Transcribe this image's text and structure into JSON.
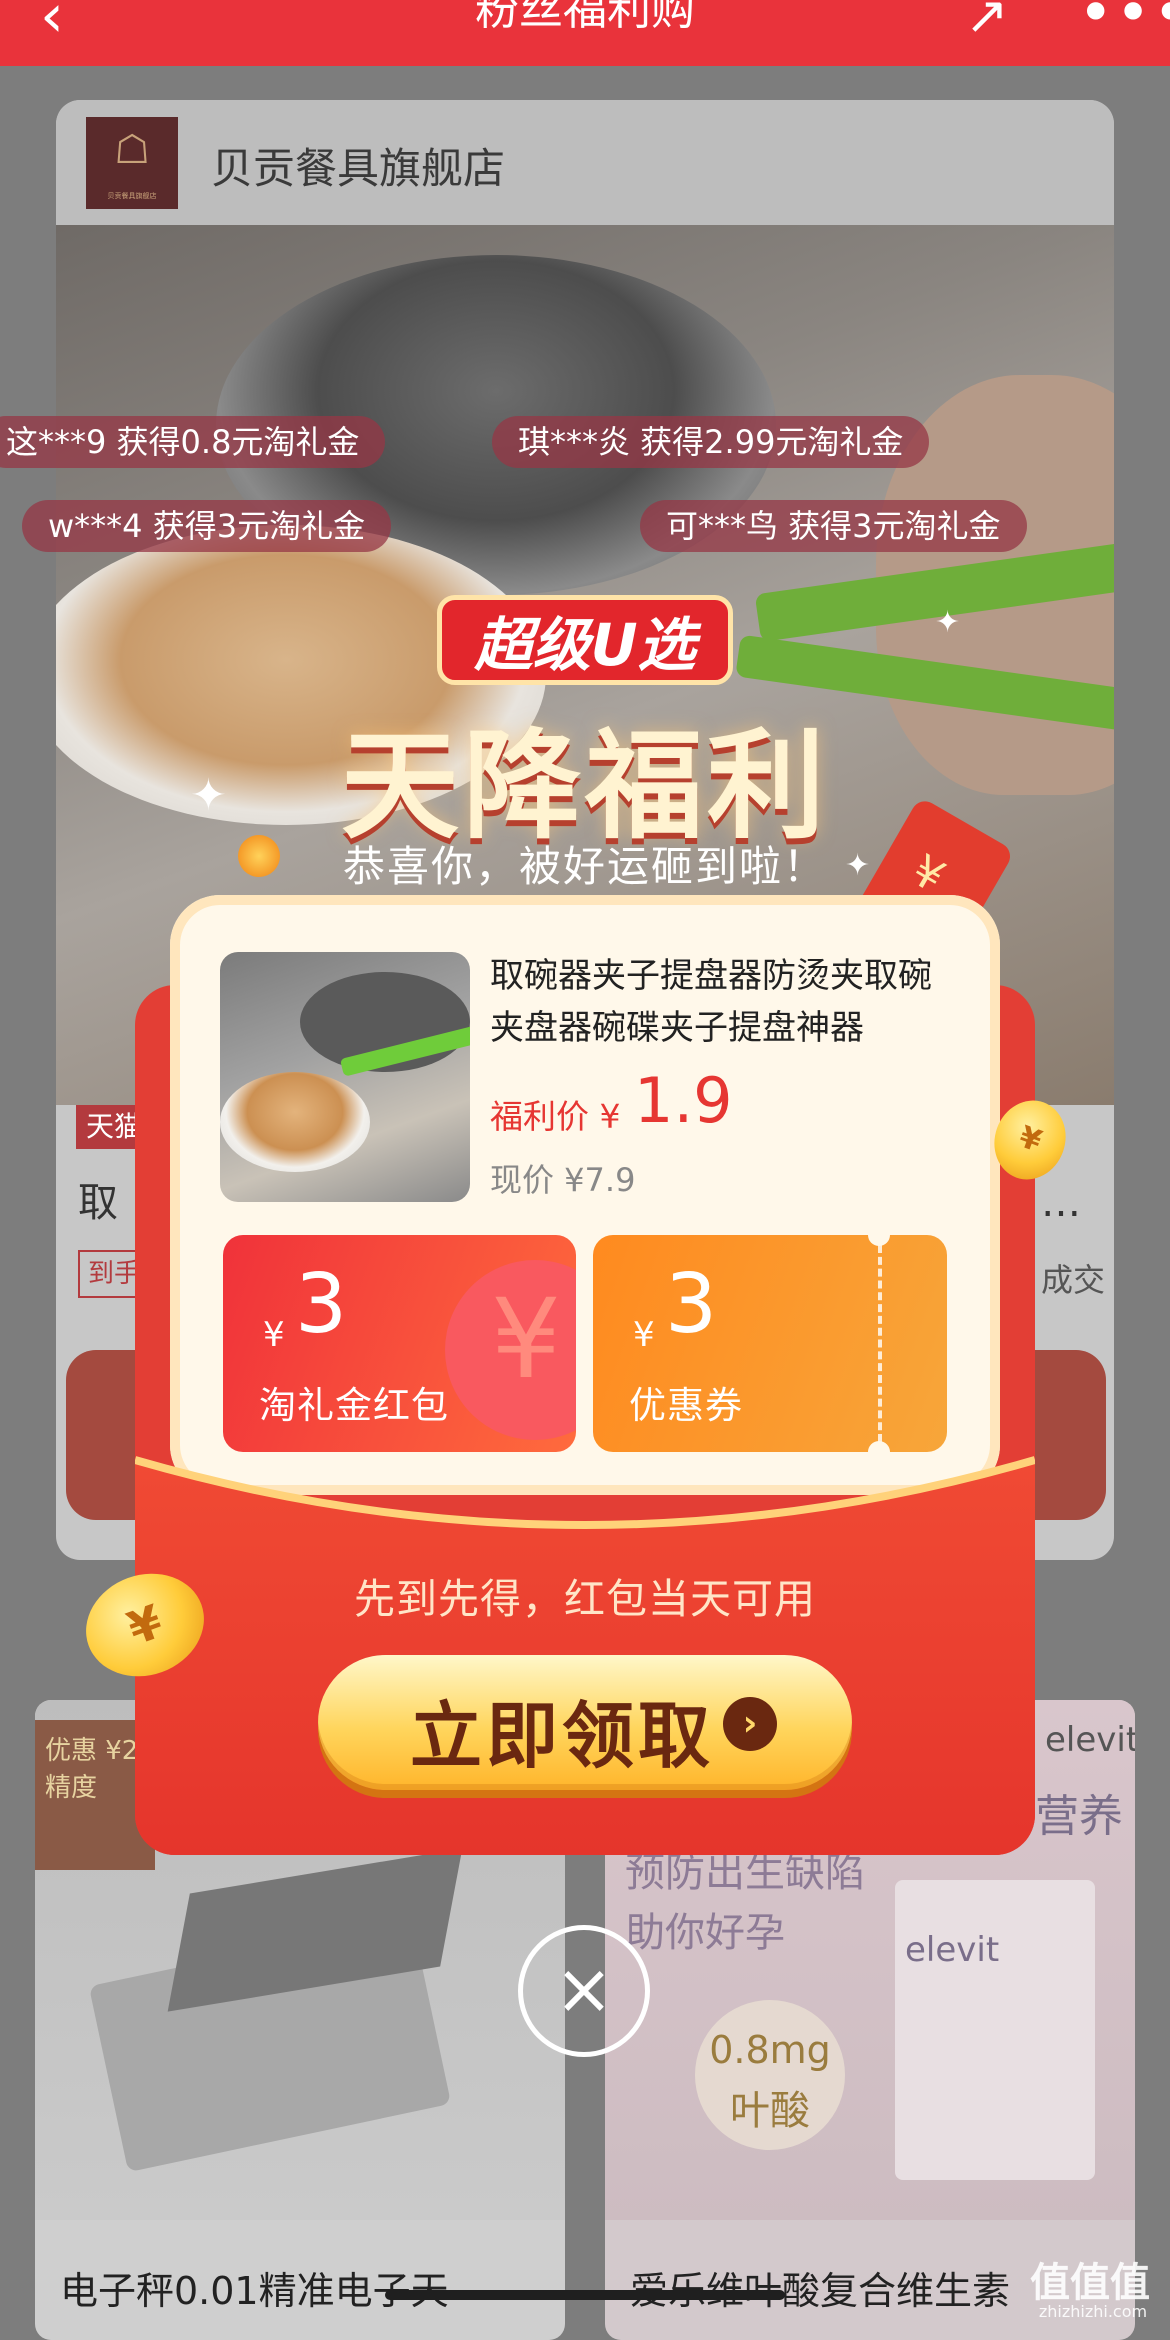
{
  "topbar": {
    "title": "粉丝福利购",
    "back_icon": "‹",
    "share_icon": "↗",
    "more_icon": "•••"
  },
  "store": {
    "name": "贝贡餐具旗舰店",
    "logo_glyph": "☖",
    "logo_caption": "贝贡餐具旗舰店"
  },
  "background": {
    "tag": "天猫",
    "title_start": "取",
    "title_end": "…",
    "sub_tag": "到手",
    "sub_end": "成交",
    "tiles": [
      {
        "name": "电子秤0.01精准电子天",
        "badge": "优惠 ¥2 精度"
      },
      {
        "name": "爱乐维叶酸复合维生素",
        "brand": "elevit",
        "head": "营养",
        "line1": "预防出生缺陷",
        "line2": "助你好孕",
        "dose": "0.8mg",
        "dose_label": "叶酸"
      }
    ]
  },
  "tickers": [
    "这***9 获得0.8元淘礼金",
    "琪***炎 获得2.99元淘礼金",
    "w***4 获得3元淘礼金",
    "可***鸟 获得3元淘礼金"
  ],
  "popup": {
    "badge": "超级U选",
    "headline": "天降福利",
    "subline": "恭喜你，被好运砸到啦！",
    "product": {
      "title": "取碗器夹子提盘器防烫夹取碗夹盘器碗碟夹子提盘神器",
      "price_label": "福利价 ¥",
      "price": "1.9",
      "original_price": "现价 ¥7.9"
    },
    "coupons": [
      {
        "currency": "¥",
        "amount": "3",
        "label": "淘礼金红包"
      },
      {
        "currency": "¥",
        "amount": "3",
        "label": "优惠券"
      }
    ],
    "notice": "先到先得，红包当天可用",
    "claim_label": "立即领取",
    "claim_arrow": "›",
    "close_icon": "×"
  },
  "watermark": {
    "text": "值值值",
    "url": "zhizhizhi.com"
  },
  "colors": {
    "primary_red": "#e9333b",
    "coupon_red": "#f0323a",
    "coupon_orange": "#ff8a1f",
    "gold": "#ffd55c"
  }
}
